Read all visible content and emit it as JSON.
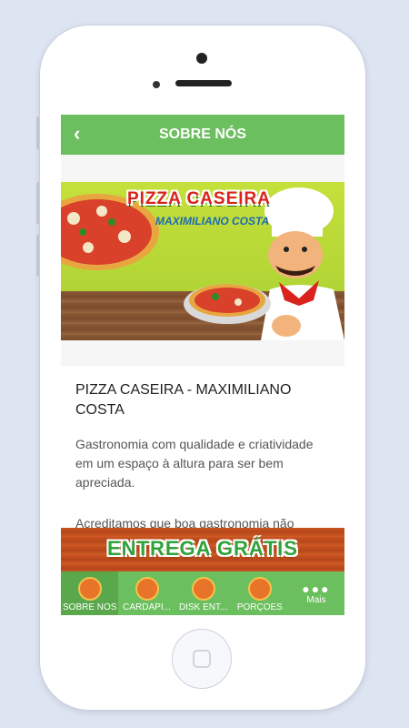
{
  "header": {
    "title": "SOBRE NÓS",
    "back_icon": "chevron-left-icon"
  },
  "banner": {
    "brand_title": "PIZZA CASEIRA",
    "brand_subtitle": "MAXIMILIANO COSTA"
  },
  "content": {
    "store_name": "PIZZA CASEIRA - MAXIMILIANO COSTA",
    "description": "Gastronomia com qualidade e criatividade em um espaço à altura para ser bem apreciada.",
    "description2": "Acreditamos que boa gastronomia não"
  },
  "promo": {
    "text": "ENTREGA GRÁTIS"
  },
  "nav": {
    "items": [
      {
        "label": "SOBRE NÓS",
        "icon": "pizza-icon",
        "active": true
      },
      {
        "label": "CARDÁPI...",
        "icon": "pizza-slice-icon",
        "active": false
      },
      {
        "label": "DISK ENT...",
        "icon": "delivery-icon",
        "active": false
      },
      {
        "label": "PORÇÕES",
        "icon": "fries-icon",
        "active": false
      },
      {
        "label": "Mais",
        "icon": "more-dots-icon",
        "active": false
      }
    ]
  },
  "colors": {
    "primary": "#6cbf5e",
    "active_tab": "#5aa84c",
    "promo_text": "#2fa33a",
    "brand_red": "#d9231c"
  }
}
